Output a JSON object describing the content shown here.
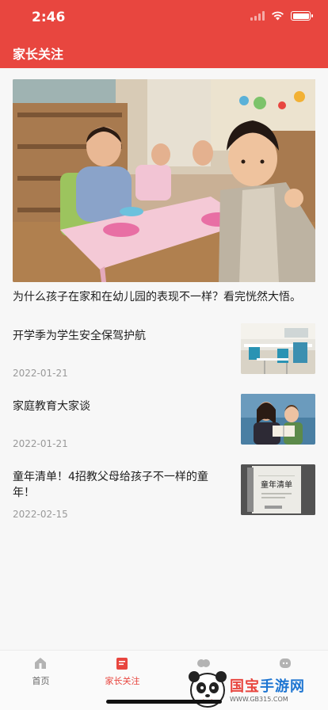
{
  "status": {
    "time": "2:46"
  },
  "header": {
    "title": "家长关注"
  },
  "hero": {
    "title": "为什么孩子在家和在幼儿园的表现不一样？看完恍然大悟。"
  },
  "news": [
    {
      "title": "开学季为学生安全保驾护航",
      "date": "2022-01-21"
    },
    {
      "title": "家庭教育大家谈",
      "date": "2022-01-21"
    },
    {
      "title": "童年清单！4招教父母给孩子不一样的童年！",
      "date": "2022-02-15"
    }
  ],
  "thumb_book": {
    "title": "童年清单"
  },
  "tabs": [
    {
      "label": "首页",
      "icon": "home-icon"
    },
    {
      "label": "家长关注",
      "icon": "bookmark-icon"
    },
    {
      "label": "家",
      "icon": "chat-icon"
    },
    {
      "label": "",
      "icon": "profile-icon"
    }
  ],
  "watermark": {
    "brand_a": "国宝",
    "brand_b": "手游网",
    "url": "WWW.GB315.COM"
  },
  "colors": {
    "accent": "#e8463f",
    "tab_inactive": "#aaaaaa"
  }
}
